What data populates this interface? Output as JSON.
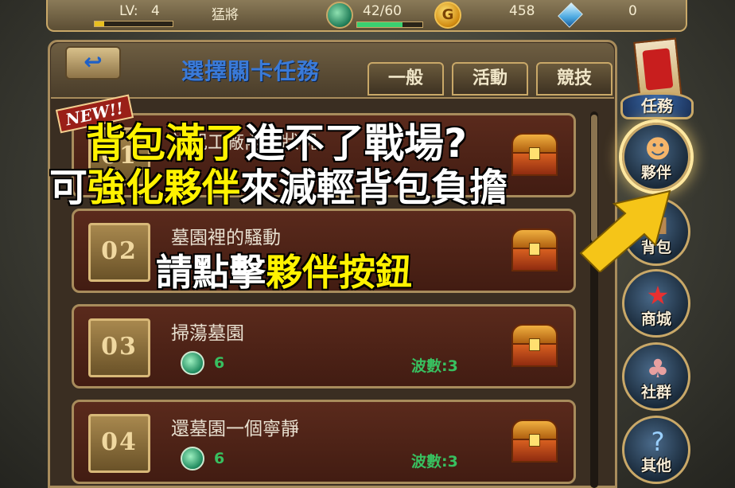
{
  "status": {
    "level_label": "LV:",
    "level": "4",
    "rank": "猛將",
    "energy": "42/60",
    "energy_fraction": 0.7,
    "level_fraction": 0.12,
    "gold_icon_letter": "G",
    "gold": "458",
    "gems": "0"
  },
  "header": {
    "back_symbol": "↩",
    "title": "選擇關卡任務",
    "tabs": [
      {
        "label": "一般",
        "active": true
      },
      {
        "label": "活動",
        "active": false
      },
      {
        "label": "競技",
        "active": false
      }
    ]
  },
  "new_badge": "NEW!!",
  "stages": [
    {
      "number": "01",
      "name": "詛咒工廠內的狀況",
      "cost": "",
      "waves": ""
    },
    {
      "number": "02",
      "name": "墓園裡的騷動",
      "cost": "",
      "waves": ""
    },
    {
      "number": "03",
      "name": "掃蕩墓園",
      "cost": "6",
      "waves": "波數:3"
    },
    {
      "number": "04",
      "name": "還墓園一個寧靜",
      "cost": "6",
      "waves": "波數:3"
    }
  ],
  "side_menu": {
    "mission": "任務",
    "partner": "夥伴",
    "bag": "背包",
    "shop": "商城",
    "community": "社群",
    "other": "其他"
  },
  "tutorial": {
    "line1_a": "背包滿了",
    "line1_b": "進不了戰場?",
    "line2_a": "可",
    "line2_b": "強化夥伴",
    "line2_c": "來減輕背包負擔",
    "line3_a": "請點擊",
    "line3_b": "夥伴按鈕"
  },
  "colors": {
    "highlight_text": "#fff200",
    "title_blue": "#3a7ad8",
    "stat_green": "#38c060",
    "arrow_yellow": "#f5c518"
  }
}
